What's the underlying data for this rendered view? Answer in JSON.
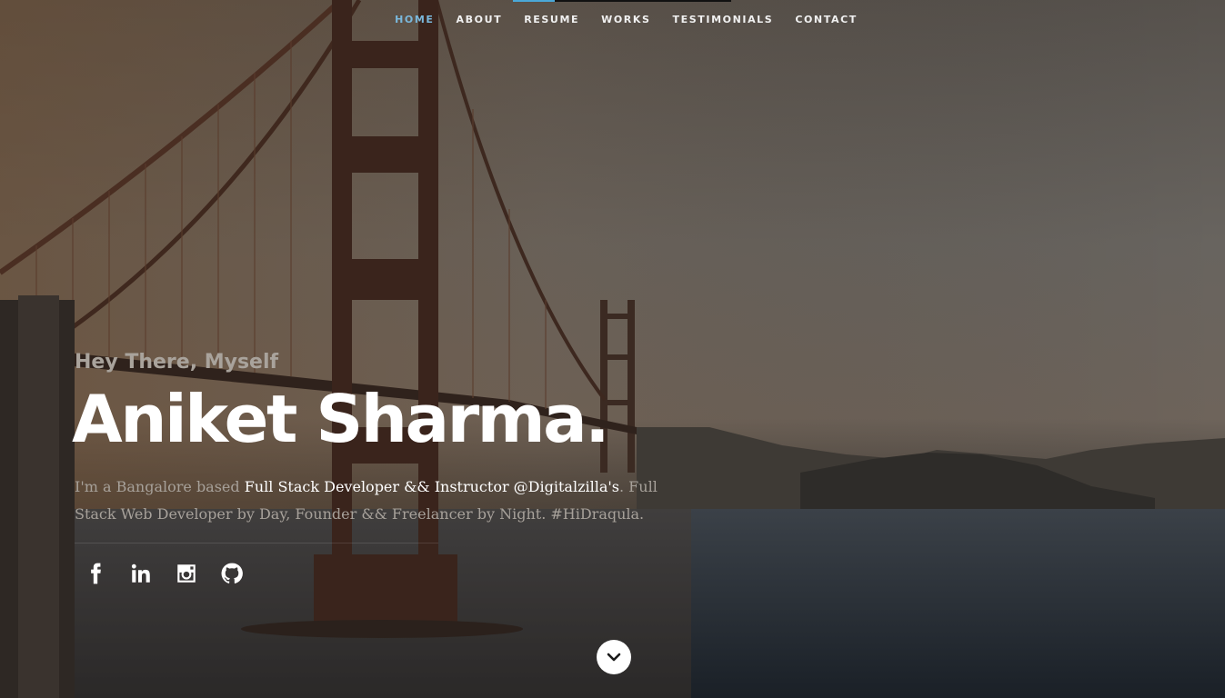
{
  "nav": {
    "items": [
      {
        "label": "HOME",
        "active": true
      },
      {
        "label": "ABOUT",
        "active": false
      },
      {
        "label": "RESUME",
        "active": false
      },
      {
        "label": "WORKS",
        "active": false
      },
      {
        "label": "TESTIMONIALS",
        "active": false
      },
      {
        "label": "CONTACT",
        "active": false
      }
    ],
    "active_color": "#7ab8dc"
  },
  "intro": {
    "greeting": "Hey There, Myself",
    "name": "Aniket Sharma.",
    "bio_prefix": "I'm a Bangalore based ",
    "bio_highlight": "Full Stack Developer && Instructor @Digitalzilla's",
    "bio_suffix": ". Full Stack Web Developer by Day, Founder && Freelancer by Night. #HiDraqula."
  },
  "social": [
    {
      "icon": "facebook-icon"
    },
    {
      "icon": "linkedin-icon"
    },
    {
      "icon": "instagram-icon"
    },
    {
      "icon": "github-icon"
    }
  ],
  "scroll_button": {
    "icon": "chevron-down-icon"
  }
}
